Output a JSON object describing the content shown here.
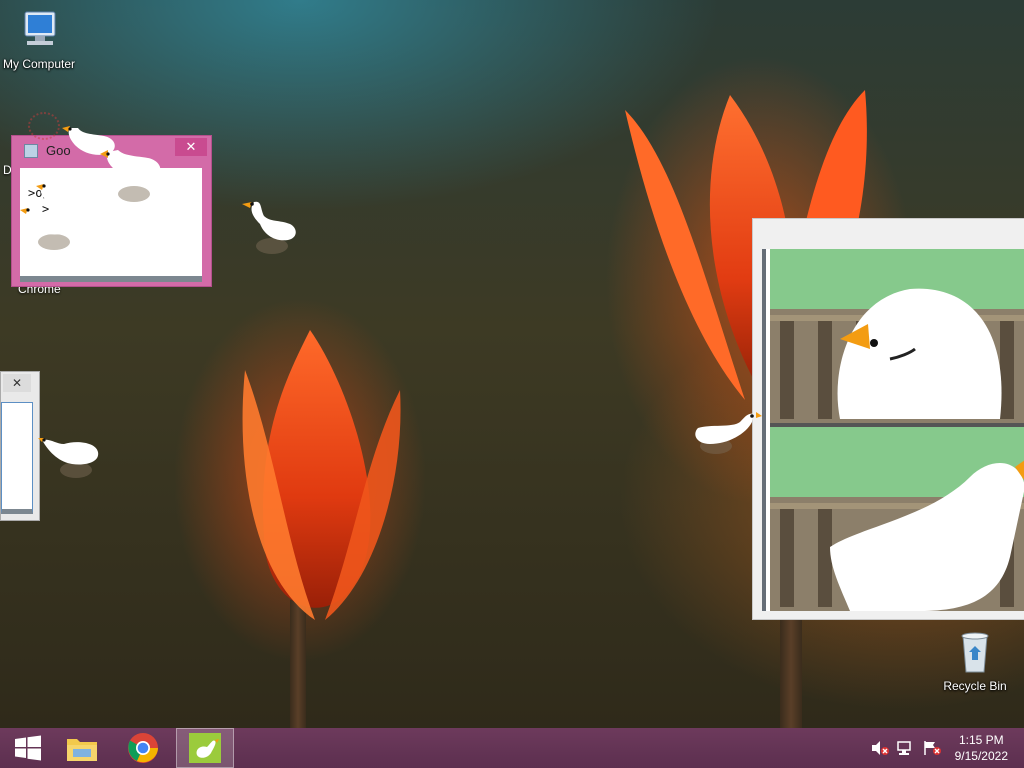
{
  "desktop": {
    "icons": [
      {
        "label": "My Computer",
        "icon": "computer-icon"
      },
      {
        "label": "Chrome",
        "icon": "chrome-icon"
      },
      {
        "label": "Recycle Bin",
        "icon": "recycle-bin-icon"
      }
    ],
    "partial_icon_label_letter": "D"
  },
  "goose_note_window": {
    "title_fragment": "Goo",
    "close_glyph": "✕",
    "text_lines": [
      ">o/",
      ">"
    ]
  },
  "left_window": {
    "close_glyph": "✕"
  },
  "meme_window": {
    "content": "two-panel goose meme image"
  },
  "taskbar": {
    "start": "windows-start-icon",
    "pinned": [
      "file-explorer-icon",
      "chrome-icon",
      "goose-app-icon"
    ],
    "tray_icons": [
      "volume-muted-icon",
      "network-icon",
      "action-center-flag-icon"
    ],
    "clock_time": "1:15 PM",
    "clock_date": "9/15/2022"
  },
  "colors": {
    "taskbar": "#5c2f4f",
    "goose_window_frame": "#d36ba8",
    "meme_grass": "#86c98c",
    "goose_beak": "#f39c12"
  }
}
